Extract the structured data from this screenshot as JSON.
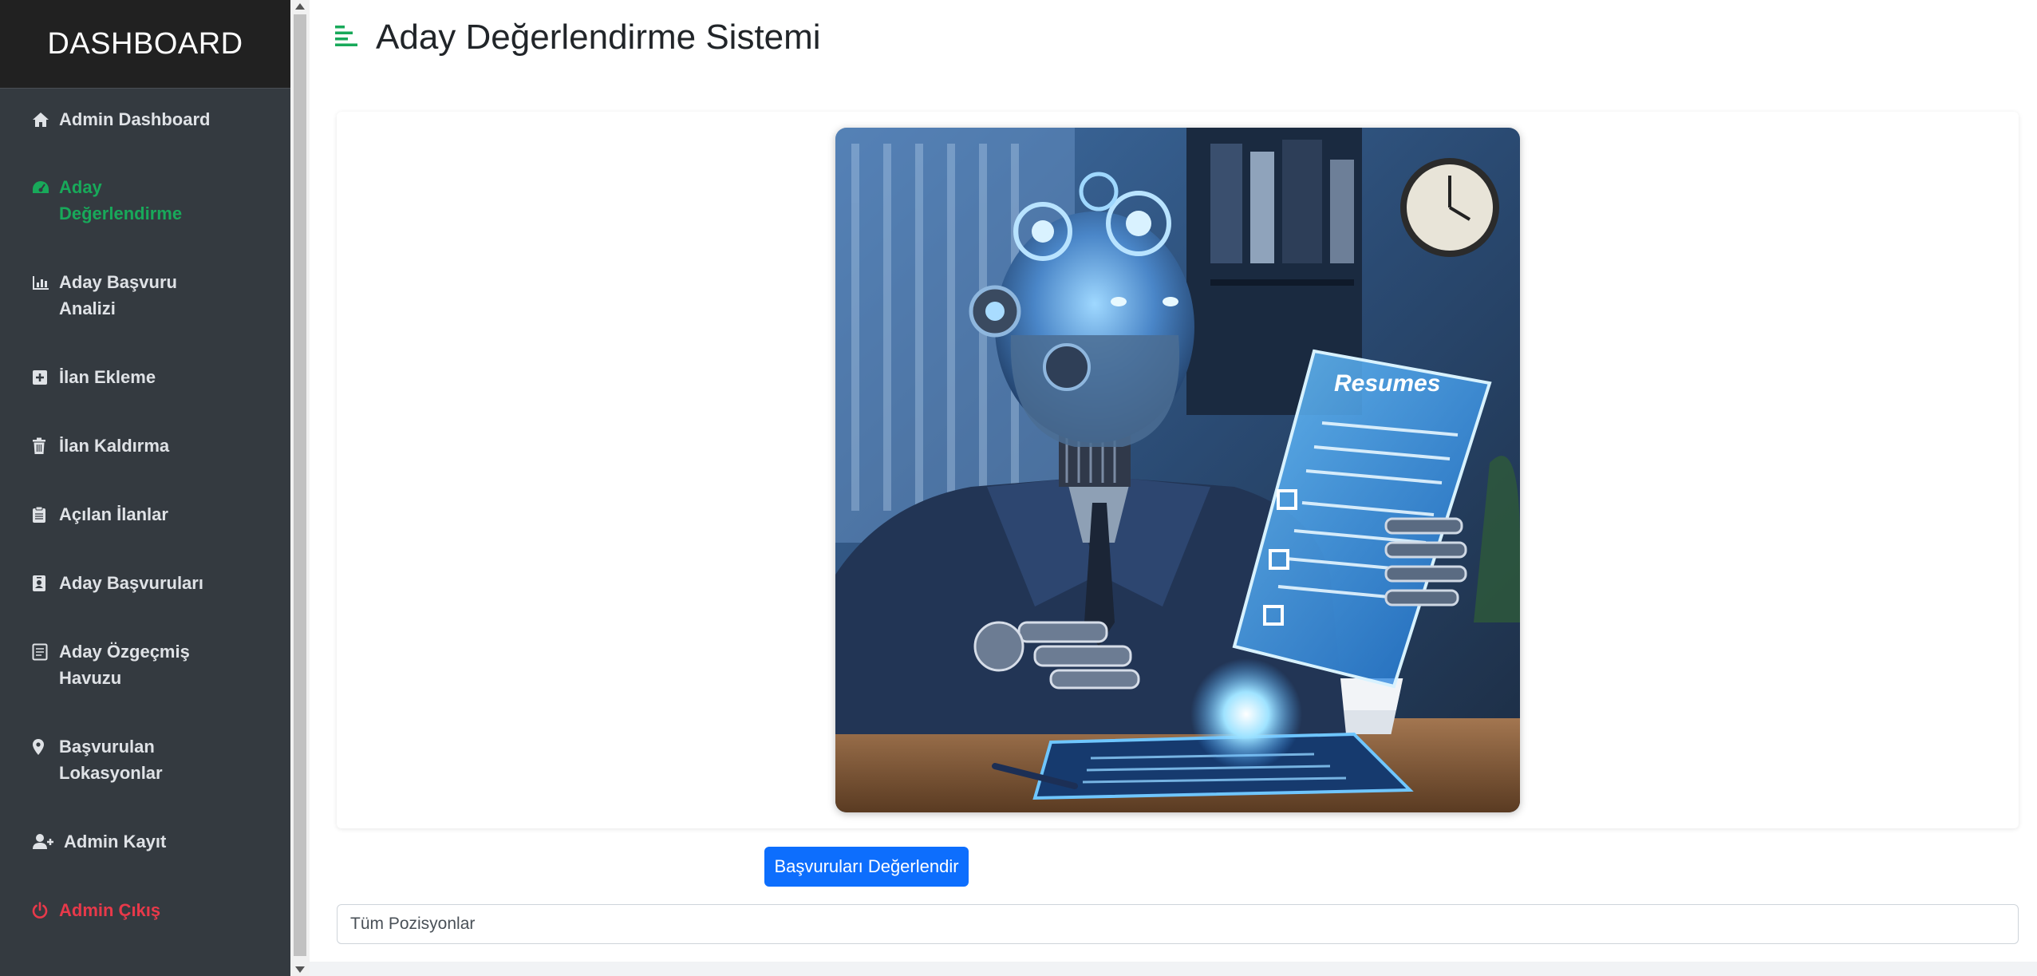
{
  "sidebar": {
    "brand": "DASHBOARD",
    "items": [
      {
        "label": "Admin Dashboard",
        "icon": "home-icon",
        "state": "normal"
      },
      {
        "label": "Aday Değerlendirme",
        "icon": "gauge-icon",
        "state": "active"
      },
      {
        "label": "Aday Başvuru Analizi",
        "icon": "chart-icon",
        "state": "normal"
      },
      {
        "label": "İlan Ekleme",
        "icon": "plus-square-icon",
        "state": "normal"
      },
      {
        "label": "İlan Kaldırma",
        "icon": "trash-icon",
        "state": "normal"
      },
      {
        "label": "Açılan İlanlar",
        "icon": "clipboard-icon",
        "state": "normal"
      },
      {
        "label": "Aday Başvuruları",
        "icon": "id-badge-icon",
        "state": "normal"
      },
      {
        "label": "Aday Özgeçmiş Havuzu",
        "icon": "document-icon",
        "state": "normal"
      },
      {
        "label": "Başvurulan Lokasyonlar",
        "icon": "map-pin-icon",
        "state": "normal"
      },
      {
        "label": "Admin Kayıt",
        "icon": "user-plus-icon",
        "state": "normal"
      },
      {
        "label": "Admin Çıkış",
        "icon": "power-icon",
        "state": "logout"
      }
    ]
  },
  "header": {
    "title": "Aday Değerlendirme Sistemi",
    "icon": "align-left-icon"
  },
  "hero": {
    "screen_title": "Resumes"
  },
  "actions": {
    "evaluate_label": "Başvuruları Değerlendir"
  },
  "filter": {
    "position_select": "Tüm Pozisyonlar"
  },
  "colors": {
    "sidebar_bg": "#343a40",
    "brand_bg": "#212121",
    "active": "#18a95a",
    "logout": "#e8394a",
    "primary": "#0d6efd"
  }
}
